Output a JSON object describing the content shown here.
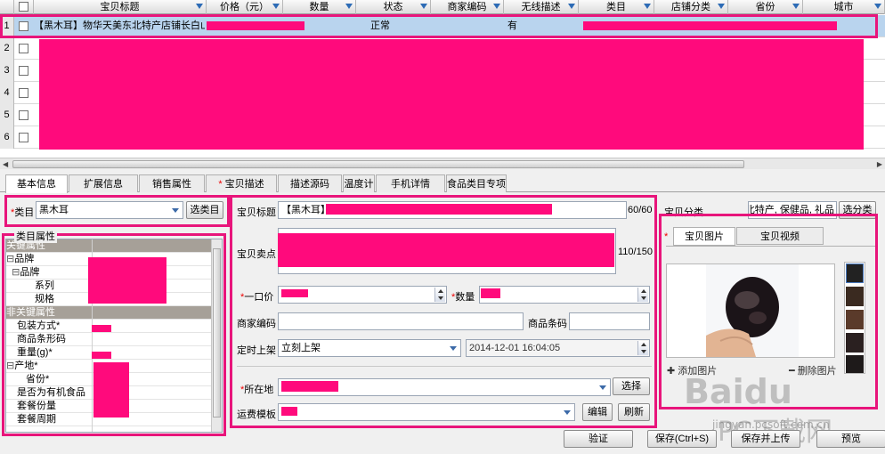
{
  "grid": {
    "columns": [
      "宝贝标题",
      "价格（元）",
      "数量",
      "状态",
      "商家编码",
      "无线描述",
      "类目",
      "店铺分类",
      "省份",
      "城市"
    ],
    "row_numbers": [
      "1",
      "2",
      "3",
      "4",
      "5",
      "6"
    ],
    "row1": {
      "title": "【黑木耳】物华天美东北特产店铺长白山…",
      "status": "正常",
      "wireless": "有"
    }
  },
  "tabs": [
    "基本信息",
    "扩展信息",
    "销售属性",
    "宝贝描述",
    "描述源码",
    "温度计",
    "手机详情",
    "食品类目专项"
  ],
  "category": {
    "label": "类目",
    "value": "黑木耳",
    "button": "选类目"
  },
  "props": {
    "group_label": "类目属性",
    "key_section": "关键属性",
    "brand_group": "品牌",
    "brand": "品牌",
    "series": "系列",
    "spec": "规格",
    "nonkey_section": "非关键属性",
    "packing": "包装方式*",
    "barcode": "商品条形码",
    "weight": "重量(g)*",
    "origin": "产地*",
    "province": "省份*",
    "organic": "是否为有机食品",
    "set_portion": "套餐份量",
    "set_period": "套餐周期"
  },
  "form": {
    "title_label": "宝贝标题",
    "title_value": "【黑木耳】",
    "title_count": "60/60",
    "selling_label": "宝贝卖点",
    "selling_count": "110/150",
    "price_label": "一口价",
    "qty_label": "数量",
    "code_label": "商家编码",
    "barcode_label": "商品条码",
    "schedule_label": "定时上架",
    "schedule_value": "立刻上架",
    "schedule_time": "2014-12-01 16:04:05",
    "location_label": "所在地",
    "location_button": "选择",
    "shipping_label": "运费模板",
    "shipping_edit": "编辑",
    "shipping_refresh": "刷新"
  },
  "shop_category": {
    "label": "宝贝分类",
    "value": "东北特产, 保健品, 礼品",
    "button": "选分类"
  },
  "images": {
    "tab_pictures": "宝贝图片",
    "tab_video": "宝贝视频",
    "add": "添加图片",
    "delete": "删除图片"
  },
  "footer": {
    "verify": "验证",
    "save": "保存(Ctrl+S)",
    "save_upload": "保存并上传",
    "preview": "预览"
  },
  "watermark": {
    "brand": "Baidu",
    "text": "PC下载网",
    "url": "jingyan.pcsoft.com.cn"
  },
  "colors": {
    "highlight": "#e8157b",
    "redaction": "#ff0a7c",
    "selection": "#b9d4ee"
  }
}
